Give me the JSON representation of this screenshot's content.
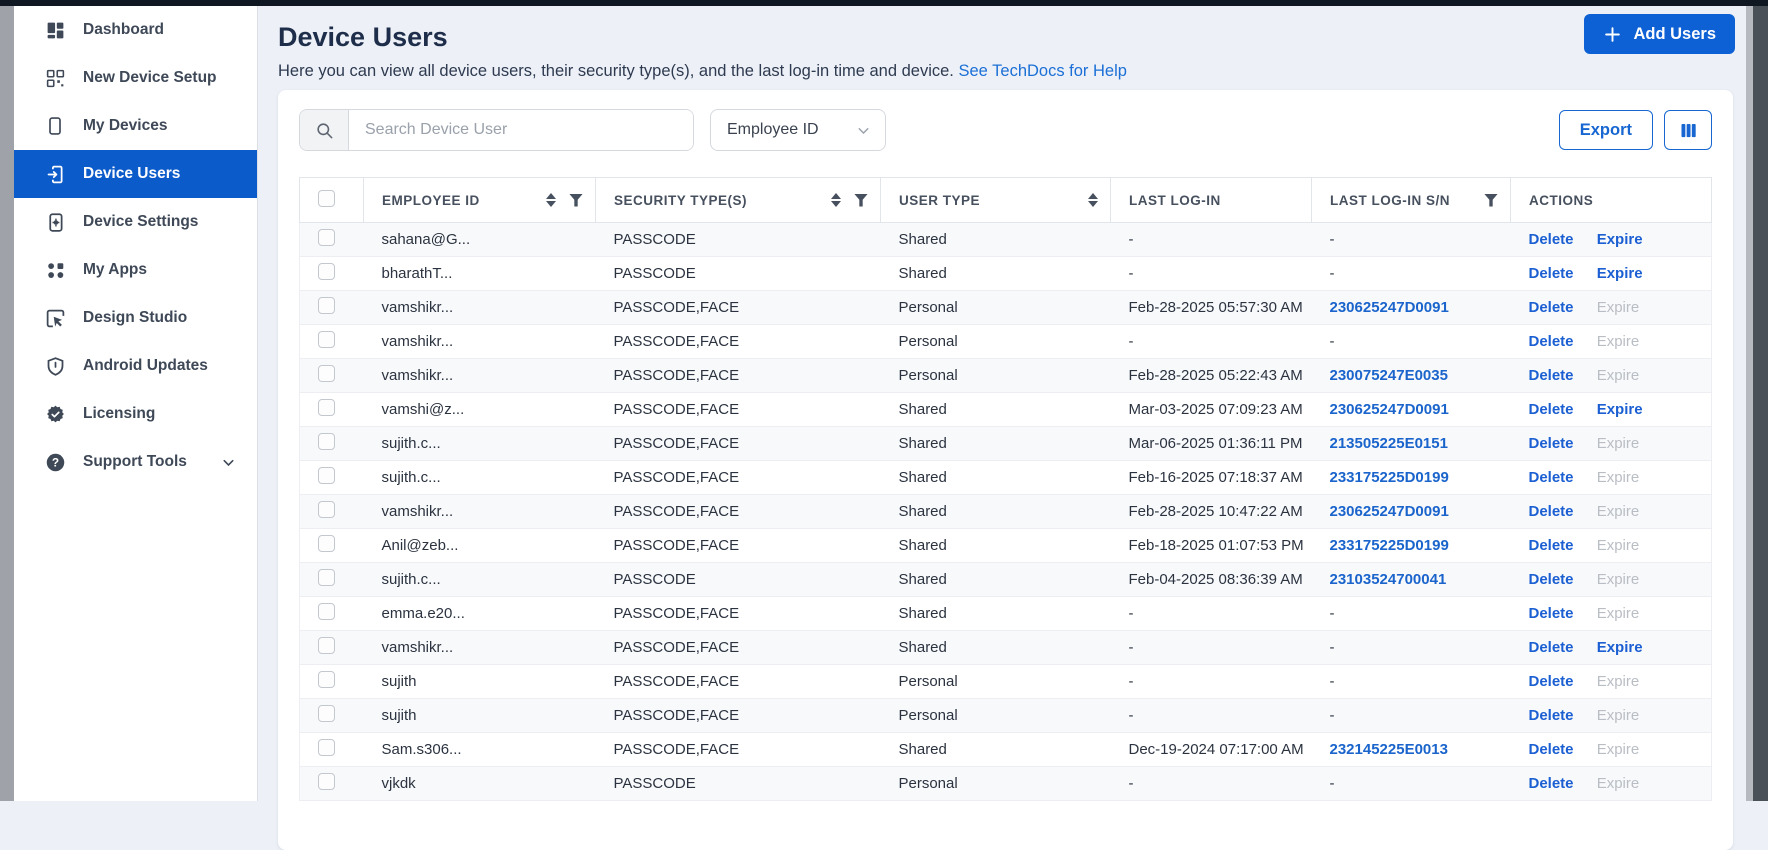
{
  "colors": {
    "accent_blue": "#0c5bca",
    "button_blue": "#0e61d4",
    "outline_blue": "#1766d1",
    "link_blue": "#1b6fd6",
    "top_bar": "#0f1722"
  },
  "sidebar": {
    "items": [
      {
        "label": "Dashboard",
        "icon": "dashboard-icon",
        "selected": false,
        "has_chevron": false
      },
      {
        "label": "New Device Setup",
        "icon": "qr-code-icon",
        "selected": false,
        "has_chevron": false
      },
      {
        "label": "My Devices",
        "icon": "smartphone-icon",
        "selected": false,
        "has_chevron": false
      },
      {
        "label": "Device Users",
        "icon": "device-user-icon",
        "selected": true,
        "has_chevron": false
      },
      {
        "label": "Device Settings",
        "icon": "device-settings-icon",
        "selected": false,
        "has_chevron": false
      },
      {
        "label": "My Apps",
        "icon": "apps-icon",
        "selected": false,
        "has_chevron": false
      },
      {
        "label": "Design Studio",
        "icon": "design-studio-icon",
        "selected": false,
        "has_chevron": false
      },
      {
        "label": "Android Updates",
        "icon": "shield-icon",
        "selected": false,
        "has_chevron": false
      },
      {
        "label": "Licensing",
        "icon": "license-badge-icon",
        "selected": false,
        "has_chevron": false
      },
      {
        "label": "Support Tools",
        "icon": "help-icon",
        "selected": false,
        "has_chevron": true
      }
    ]
  },
  "header": {
    "title": "Device Users",
    "subtitle": "Here you can view all device users, their security type(s), and the last log-in time and device.",
    "subtitle_link": "See TechDocs for Help",
    "add_users_label": "Add Users"
  },
  "toolbar": {
    "search_placeholder": "Search Device User",
    "filter_dropdown_value": "Employee ID",
    "export_label": "Export"
  },
  "table": {
    "columns": [
      {
        "label": "EMPLOYEE ID",
        "sort": true,
        "filter": true
      },
      {
        "label": "SECURITY TYPE(S)",
        "sort": true,
        "filter": true
      },
      {
        "label": "USER TYPE",
        "sort": true,
        "filter": false
      },
      {
        "label": "LAST LOG-IN",
        "sort": false,
        "filter": false
      },
      {
        "label": "LAST LOG-IN S/N",
        "sort": false,
        "filter": true
      },
      {
        "label": "ACTIONS",
        "sort": false,
        "filter": false
      }
    ],
    "action_labels": {
      "delete": "Delete",
      "expire": "Expire"
    },
    "rows": [
      {
        "employee_id": "sahana@G...",
        "security_types": "PASSCODE",
        "user_type": "Shared",
        "last_login": "-",
        "last_login_sn": "-",
        "expire_enabled": true
      },
      {
        "employee_id": "bharathT...",
        "security_types": "PASSCODE",
        "user_type": "Shared",
        "last_login": "-",
        "last_login_sn": "-",
        "expire_enabled": true
      },
      {
        "employee_id": "vamshikr...",
        "security_types": "PASSCODE,FACE",
        "user_type": "Personal",
        "last_login": "Feb-28-2025 05:57:30 AM",
        "last_login_sn": "230625247D0091",
        "expire_enabled": false
      },
      {
        "employee_id": "vamshikr...",
        "security_types": "PASSCODE,FACE",
        "user_type": "Personal",
        "last_login": "-",
        "last_login_sn": "-",
        "expire_enabled": false
      },
      {
        "employee_id": "vamshikr...",
        "security_types": "PASSCODE,FACE",
        "user_type": "Personal",
        "last_login": "Feb-28-2025 05:22:43 AM",
        "last_login_sn": "230075247E0035",
        "expire_enabled": false
      },
      {
        "employee_id": "vamshi@z...",
        "security_types": "PASSCODE,FACE",
        "user_type": "Shared",
        "last_login": "Mar-03-2025 07:09:23 AM",
        "last_login_sn": "230625247D0091",
        "expire_enabled": true
      },
      {
        "employee_id": "sujith.c...",
        "security_types": "PASSCODE,FACE",
        "user_type": "Shared",
        "last_login": "Mar-06-2025 01:36:11 PM",
        "last_login_sn": "213505225E0151",
        "expire_enabled": false
      },
      {
        "employee_id": "sujith.c...",
        "security_types": "PASSCODE,FACE",
        "user_type": "Shared",
        "last_login": "Feb-16-2025 07:18:37 AM",
        "last_login_sn": "233175225D0199",
        "expire_enabled": false
      },
      {
        "employee_id": "vamshikr...",
        "security_types": "PASSCODE,FACE",
        "user_type": "Shared",
        "last_login": "Feb-28-2025 10:47:22 AM",
        "last_login_sn": "230625247D0091",
        "expire_enabled": false
      },
      {
        "employee_id": "Anil@zeb...",
        "security_types": "PASSCODE,FACE",
        "user_type": "Shared",
        "last_login": "Feb-18-2025 01:07:53 PM",
        "last_login_sn": "233175225D0199",
        "expire_enabled": false
      },
      {
        "employee_id": "sujith.c...",
        "security_types": "PASSCODE",
        "user_type": "Shared",
        "last_login": "Feb-04-2025 08:36:39 AM",
        "last_login_sn": "23103524700041",
        "expire_enabled": false
      },
      {
        "employee_id": "emma.e20...",
        "security_types": "PASSCODE,FACE",
        "user_type": "Shared",
        "last_login": "-",
        "last_login_sn": "-",
        "expire_enabled": false
      },
      {
        "employee_id": "vamshikr...",
        "security_types": "PASSCODE,FACE",
        "user_type": "Shared",
        "last_login": "-",
        "last_login_sn": "-",
        "expire_enabled": true
      },
      {
        "employee_id": "sujith",
        "security_types": "PASSCODE,FACE",
        "user_type": "Personal",
        "last_login": "-",
        "last_login_sn": "-",
        "expire_enabled": false
      },
      {
        "employee_id": "sujith",
        "security_types": "PASSCODE,FACE",
        "user_type": "Personal",
        "last_login": "-",
        "last_login_sn": "-",
        "expire_enabled": false
      },
      {
        "employee_id": "Sam.s306...",
        "security_types": "PASSCODE,FACE",
        "user_type": "Shared",
        "last_login": "Dec-19-2024 07:17:00 AM",
        "last_login_sn": "232145225E0013",
        "expire_enabled": false
      },
      {
        "employee_id": "vjkdk",
        "security_types": "PASSCODE",
        "user_type": "Personal",
        "last_login": "-",
        "last_login_sn": "-",
        "expire_enabled": false
      }
    ]
  }
}
